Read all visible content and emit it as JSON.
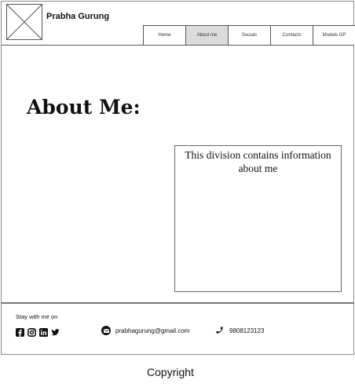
{
  "header": {
    "brand_name": "Prabha Gurung",
    "nav": [
      {
        "label": "Home"
      },
      {
        "label": "About me",
        "active": true
      },
      {
        "label": "Socials"
      },
      {
        "label": "Contacts"
      },
      {
        "label": "Models GP"
      }
    ]
  },
  "main": {
    "heading": "About Me:",
    "info_text": "This division contains information about me"
  },
  "footer": {
    "stay_label": "Stay with me on",
    "social_icons": [
      "facebook-icon",
      "instagram-icon",
      "linkedin-icon",
      "twitter-icon"
    ],
    "email": "prabhagurung@gmail.com",
    "phone": "9808123123"
  },
  "copyright": "Copyright",
  "colors": {
    "active_nav_bg": "#dcdcdc",
    "border": "#555555",
    "text": "#111111"
  }
}
